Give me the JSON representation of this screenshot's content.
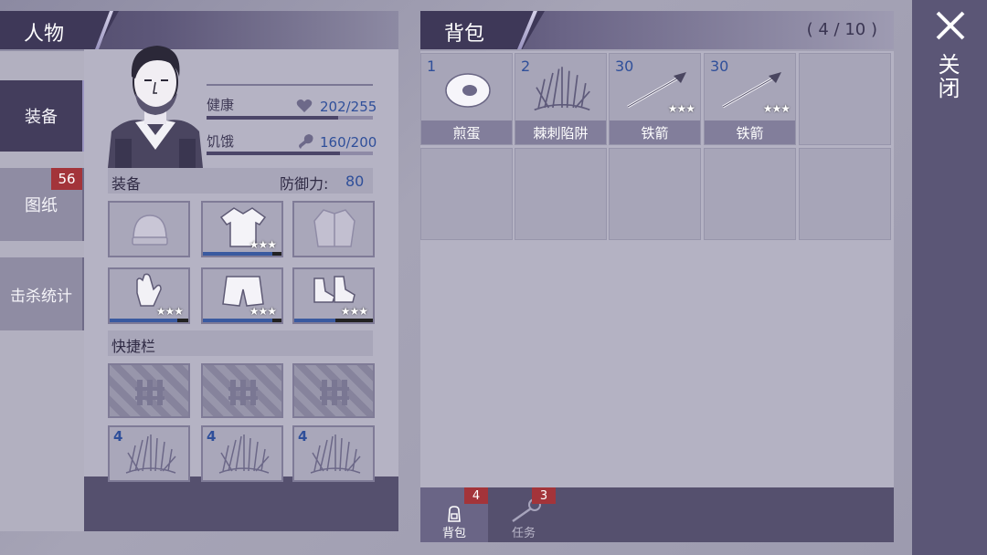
{
  "character": {
    "title": "人物",
    "tabs": [
      {
        "label": "装备"
      },
      {
        "label": "图纸",
        "badge": "56"
      },
      {
        "label": "击杀统计"
      }
    ],
    "stats": {
      "health_label": "健康",
      "health_value": "202/255",
      "health_fraction": 0.79,
      "hunger_label": "饥饿",
      "hunger_value": "160/200",
      "hunger_fraction": 0.8
    },
    "equipment": {
      "label": "装备",
      "defense_label": "防御力:",
      "defense_value": "80",
      "slots": [
        {
          "icon": "beanie-icon",
          "stars": ""
        },
        {
          "icon": "shirt-icon",
          "stars": "★★★",
          "durability": 0.88
        },
        {
          "icon": "coat-icon",
          "stars": ""
        },
        {
          "icon": "gloves-icon",
          "stars": "★★★",
          "durability": 0.86
        },
        {
          "icon": "shorts-icon",
          "stars": "★★★",
          "durability": 0.88
        },
        {
          "icon": "boots-icon",
          "stars": "★★★",
          "durability": 0.52
        }
      ]
    },
    "quickbar": {
      "label": "快捷栏",
      "locked_slots": [
        {
          "icon": "fence-icon"
        },
        {
          "icon": "fence-icon"
        },
        {
          "icon": "fence-icon"
        }
      ],
      "item_slots": [
        {
          "qty": "4",
          "icon": "thorn-trap-icon"
        },
        {
          "qty": "4",
          "icon": "thorn-trap-icon"
        },
        {
          "qty": "4",
          "icon": "thorn-trap-icon"
        }
      ]
    }
  },
  "bag": {
    "title": "背包",
    "count": "( 4 / 10 )",
    "items": [
      {
        "qty": "1",
        "name": "煎蛋",
        "icon": "fried-egg-icon",
        "stars": ""
      },
      {
        "qty": "2",
        "name": "棘刺陷阱",
        "icon": "thorn-trap-icon",
        "stars": ""
      },
      {
        "qty": "30",
        "name": "铁箭",
        "icon": "iron-arrow-icon",
        "stars": "★★★"
      },
      {
        "qty": "30",
        "name": "铁箭",
        "icon": "iron-arrow-icon",
        "stars": "★★★"
      }
    ],
    "footer": [
      {
        "label": "背包",
        "badge": "4",
        "icon": "backpack-icon"
      },
      {
        "label": "任务",
        "badge": "3",
        "icon": "key-icon"
      }
    ]
  },
  "close": {
    "label": "关闭",
    "icon": "close-icon"
  },
  "colors": {
    "accent_dark": "#3e3858",
    "badge_red": "#a3343a",
    "value_blue": "#2f4f9a"
  }
}
